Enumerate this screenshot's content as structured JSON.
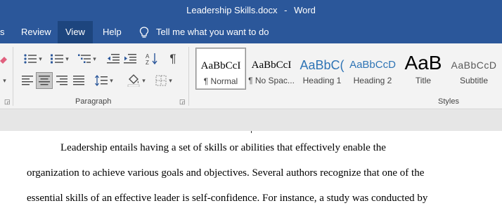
{
  "window": {
    "doc_name": "Leadership Skills.docx",
    "separator": "-",
    "app": "Word"
  },
  "tabs": [
    {
      "label": "s",
      "active": false
    },
    {
      "label": "Review",
      "active": false
    },
    {
      "label": "View",
      "active": true
    },
    {
      "label": "Help",
      "active": false
    }
  ],
  "tell_me": {
    "label": "Tell me what you want to do",
    "icon": "lightbulb-icon"
  },
  "ribbon": {
    "paragraph_group": {
      "label": "Paragraph"
    },
    "styles_group": {
      "label": "Styles"
    },
    "styles": [
      {
        "sample": "AaBbCcI",
        "name": "¶ Normal",
        "selected": true,
        "color": "#000000"
      },
      {
        "sample": "AaBbCcI",
        "name": "¶ No Spac...",
        "selected": false,
        "color": "#000000"
      },
      {
        "sample": "AaBbC(",
        "name": "Heading 1",
        "selected": false,
        "color": "#2e74b5"
      },
      {
        "sample": "AaBbCcD",
        "name": "Heading 2",
        "selected": false,
        "color": "#2e74b5"
      },
      {
        "sample": "AaB",
        "name": "Title",
        "selected": false,
        "color": "#000000"
      },
      {
        "sample": "AaBbCcD",
        "name": "Subtitle",
        "selected": false,
        "color": "#595959"
      }
    ]
  },
  "document": {
    "lines": [
      "Leadership entails having a set of skills or abilities that effectively enable the",
      "organization to achieve various goals and objectives. Several authors recognize that one of the",
      "essential skills of an effective leader is self-confidence. For instance, a study was conducted by"
    ]
  },
  "colors": {
    "accent": "#2b579a",
    "active_tab": "#1d457e",
    "ribbon": "#f3f3f3",
    "heading": "#2e74b5"
  }
}
